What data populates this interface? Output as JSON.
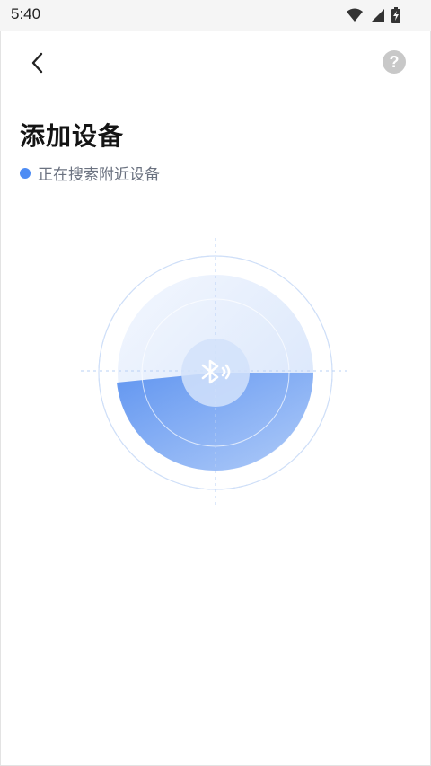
{
  "status_bar": {
    "time": "5:40",
    "icons": [
      "wifi-icon",
      "cellular-signal-icon",
      "battery-charging-icon"
    ]
  },
  "nav": {
    "back_icon": "chevron-left-icon",
    "help_label": "?"
  },
  "page": {
    "title": "添加设备",
    "status_text": "正在搜索附近设备"
  },
  "radar": {
    "center_icon": "bluetooth-icon"
  },
  "colors": {
    "accent": "#4e8cf4",
    "radar_light": "#e8f0fd",
    "help_gray": "#c8c8c8",
    "status_text": "#6b7280"
  }
}
